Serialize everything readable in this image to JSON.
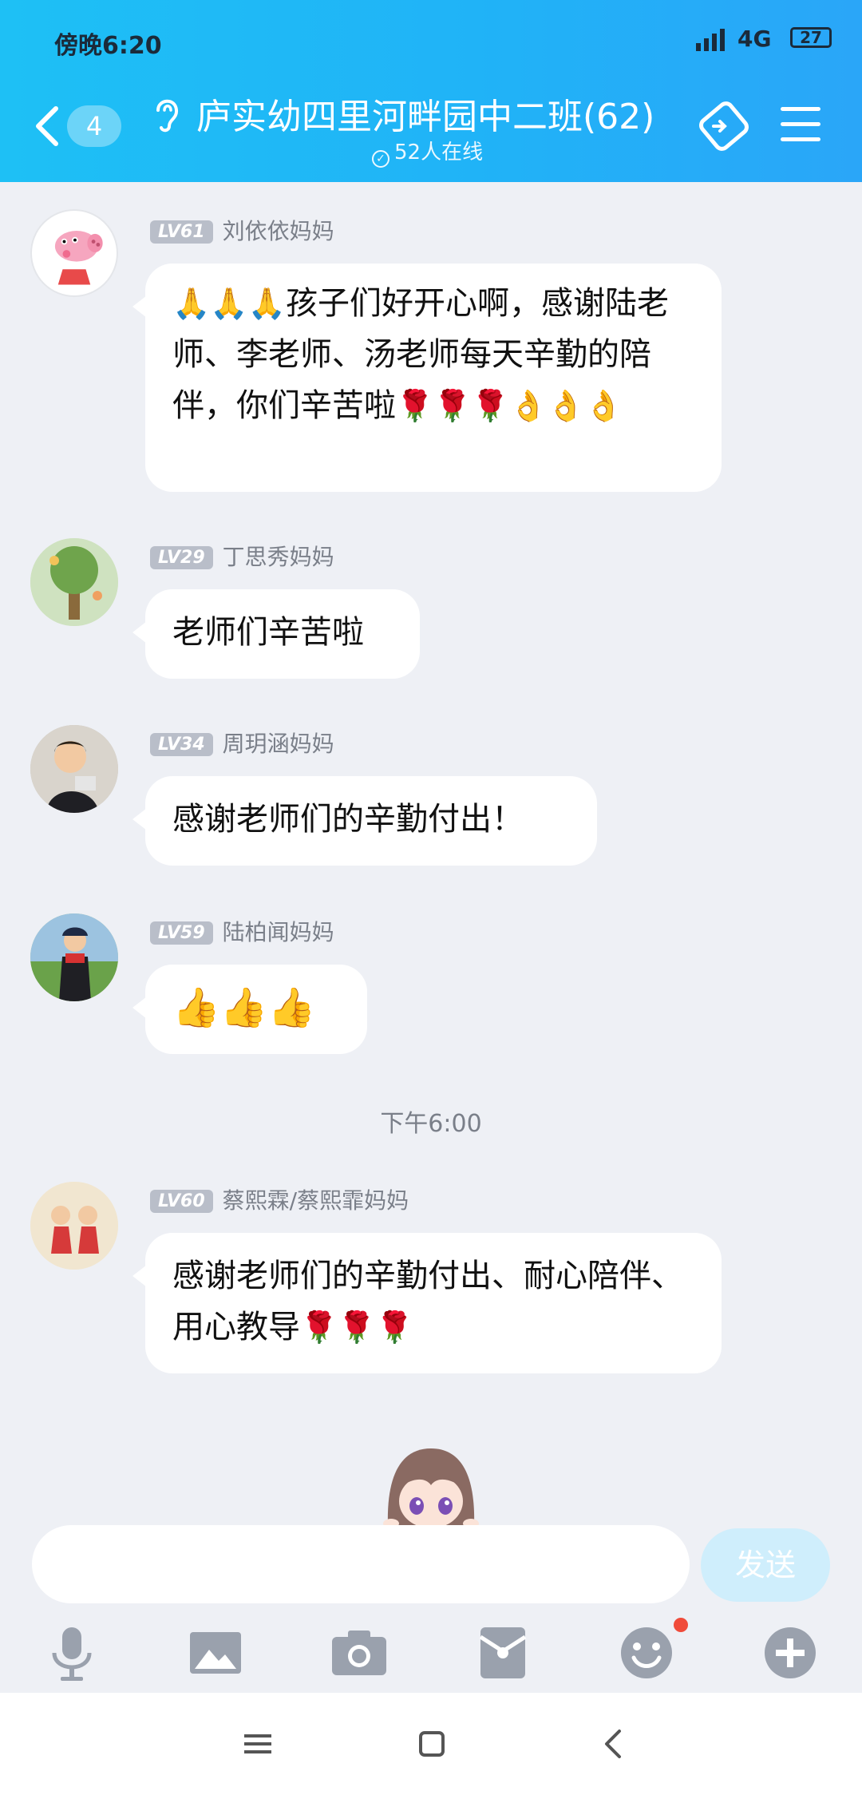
{
  "status_bar": {
    "time": "傍晚6:20",
    "network": "4G",
    "battery": "27"
  },
  "header": {
    "back_count": "4",
    "title": "庐实幼四里河畔园中二班(62)",
    "online": "52人在线"
  },
  "messages": [
    {
      "level": "LV61",
      "sender": "刘依依妈妈",
      "emoji_lead": "🙏🙏🙏",
      "text": "孩子们好开心啊，感谢陆老师、李老师、汤老师每天辛勤的陪伴，你们辛苦啦",
      "emoji_trail": "🌹🌹🌹👌👌👌"
    },
    {
      "level": "LV29",
      "sender": "丁思秀妈妈",
      "text": "老师们辛苦啦"
    },
    {
      "level": "LV34",
      "sender": "周玥涵妈妈",
      "text": "感谢老师们的辛勤付出！"
    },
    {
      "level": "LV59",
      "sender": "陆柏闻妈妈",
      "text": "👍👍👍"
    },
    {
      "level": "LV60",
      "sender": "蔡熙霖/蔡熙霏妈妈",
      "text": "感谢老师们的辛勤付出、耐心陪伴、用心教导",
      "emoji_trail": "🌹🌹🌹"
    }
  ],
  "timestamp": "下午6:00",
  "composer": {
    "send_label": "发送"
  },
  "icons": [
    "mic-icon",
    "image-icon",
    "camera-icon",
    "red-packet-icon",
    "emoji-icon",
    "plus-icon"
  ],
  "colors": {
    "header": "#20b3f7",
    "background": "#eef0f5",
    "send_button": "#cfeefc"
  }
}
